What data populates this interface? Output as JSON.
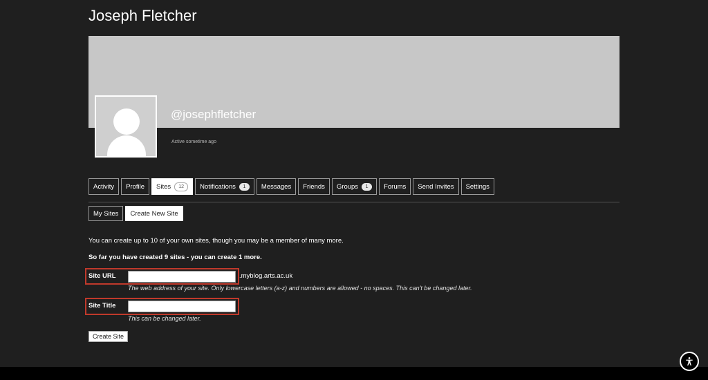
{
  "profile": {
    "name": "Joseph Fletcher",
    "handle": "@josephfletcher",
    "active": "Active sometime ago"
  },
  "tabs": [
    {
      "label": "Activity"
    },
    {
      "label": "Profile"
    },
    {
      "label": "Sites",
      "count": "12",
      "current": true
    },
    {
      "label": "Notifications",
      "count": "1"
    },
    {
      "label": "Messages"
    },
    {
      "label": "Friends"
    },
    {
      "label": "Groups",
      "count": "1"
    },
    {
      "label": "Forums"
    },
    {
      "label": "Send Invites"
    },
    {
      "label": "Settings"
    }
  ],
  "subnav": [
    {
      "label": "My Sites"
    },
    {
      "label": "Create New Site",
      "current": true
    }
  ],
  "form": {
    "intro": "You can create up to 10 of your own sites, though you may be a member of many more.",
    "quota": "So far you have created 9 sites - you can create 1 more.",
    "site_url": {
      "label": "Site URL",
      "value": "",
      "suffix": ".myblog.arts.ac.uk",
      "help": "The web address of your site. Only lowercase letters (a-z) and numbers are allowed - no spaces. This can't be changed later."
    },
    "site_title": {
      "label": "Site Title",
      "value": "",
      "help": "This can be changed later."
    },
    "submit_label": "Create Site"
  },
  "colors": {
    "background": "#1f1f1f",
    "cover": "#c7c7c7",
    "highlight": "#c0392b"
  },
  "icons": {
    "accessibility": "accessibility-icon"
  }
}
